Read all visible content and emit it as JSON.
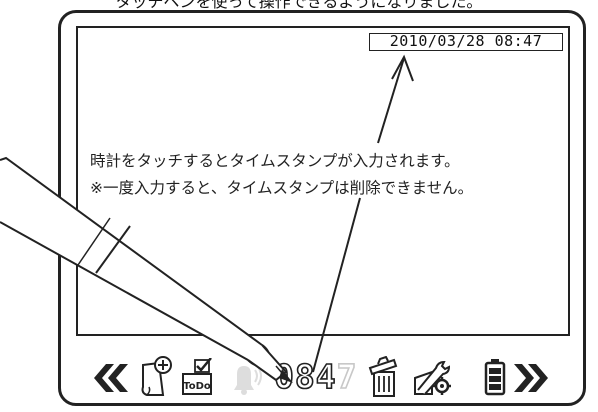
{
  "caption": "タッチペンを使って操作できるようになりました。",
  "screen": {
    "timestamp": "2010/03/28 08:47",
    "note_line1": "時計をタッチするとタイムスタンプが入力されます。",
    "note_line2": "※一度入力すると、タイムスタンプは削除できません。"
  },
  "toolbar": {
    "prev_icon": "double-chevron-left-icon",
    "new_page_icon": "new-page-plus-icon",
    "todo_icon": "todo-icon",
    "todo_label": "ToDo",
    "alarm_icon": "bell-icon",
    "clock_hours": "08",
    "clock_minutes_a": "4",
    "clock_minutes_b": "7",
    "trash_icon": "trash-icon",
    "settings_icon": "tools-settings-icon",
    "battery_icon": "battery-icon",
    "next_icon": "double-chevron-right-icon"
  },
  "colors": {
    "ink": "#222222",
    "disabled": "#c8c8c8",
    "background": "#ffffff"
  }
}
